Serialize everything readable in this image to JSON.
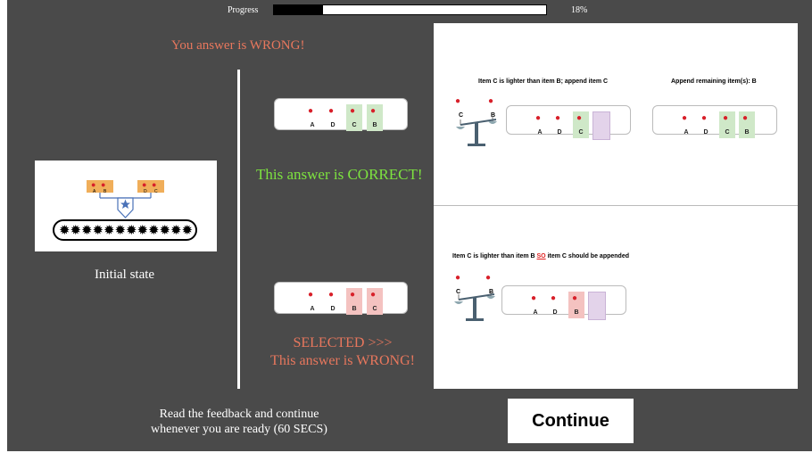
{
  "progress": {
    "label": "Progress",
    "value_text": "18%",
    "fill_fraction": 0.18
  },
  "feedback_top": "You answer is WRONG!",
  "initial": {
    "caption": "Initial state",
    "left_pan_labels": [
      "A",
      "B"
    ],
    "right_pan_labels": [
      "D",
      "C"
    ],
    "star_icon": "star-icon",
    "conveyor_icon": "conveyor-belt-icon"
  },
  "option_correct": {
    "slots": [
      {
        "label": "A",
        "highlight": "none"
      },
      {
        "label": "D",
        "highlight": "none"
      },
      {
        "label": "C",
        "highlight": "green"
      },
      {
        "label": "B",
        "highlight": "green"
      }
    ],
    "result_text": "This answer is CORRECT!"
  },
  "option_selected": {
    "slots": [
      {
        "label": "A",
        "highlight": "none"
      },
      {
        "label": "D",
        "highlight": "none"
      },
      {
        "label": "B",
        "highlight": "red"
      },
      {
        "label": "C",
        "highlight": "red"
      }
    ],
    "selected_text": "SELECTED >>>",
    "result_text": "This answer is WRONG!"
  },
  "feedback_panel": {
    "correct": {
      "step1_title": "Item C is lighter than item B; append item C",
      "scale_labels": {
        "left": "C",
        "right": "B"
      },
      "step1_slots": [
        {
          "label": "A",
          "highlight": "none"
        },
        {
          "label": "D",
          "highlight": "none"
        },
        {
          "label": "C",
          "highlight": "green"
        },
        {
          "label": "",
          "highlight": "purple"
        }
      ],
      "step2_title": "Append remaining item(s): B",
      "step2_slots": [
        {
          "label": "A",
          "highlight": "none"
        },
        {
          "label": "D",
          "highlight": "none"
        },
        {
          "label": "C",
          "highlight": "green"
        },
        {
          "label": "B",
          "highlight": "green"
        }
      ]
    },
    "wrong": {
      "title_before": "Item C is lighter than item B ",
      "title_so": "SO",
      "title_after": " item C should be appended",
      "scale_labels": {
        "left": "C",
        "right": "B"
      },
      "slots": [
        {
          "label": "A",
          "highlight": "none"
        },
        {
          "label": "D",
          "highlight": "none"
        },
        {
          "label": "B",
          "highlight": "red"
        },
        {
          "label": "",
          "highlight": "purple"
        }
      ]
    }
  },
  "instruction": {
    "line1": "Read the feedback and continue",
    "line2": "whenever you are ready (60 SECS)"
  },
  "continue_label": "Continue",
  "colors": {
    "background": "#4a4a4a",
    "correct_green": "#7de23f",
    "wrong_red": "#e8775d",
    "slot_green": "#cfe8c8",
    "slot_red": "#f4c2c0",
    "slot_purple": "#e3d3ea",
    "apple": "#d8202a"
  },
  "icons": {
    "apple": "apple-icon",
    "scale": "balance-scale-icon"
  }
}
